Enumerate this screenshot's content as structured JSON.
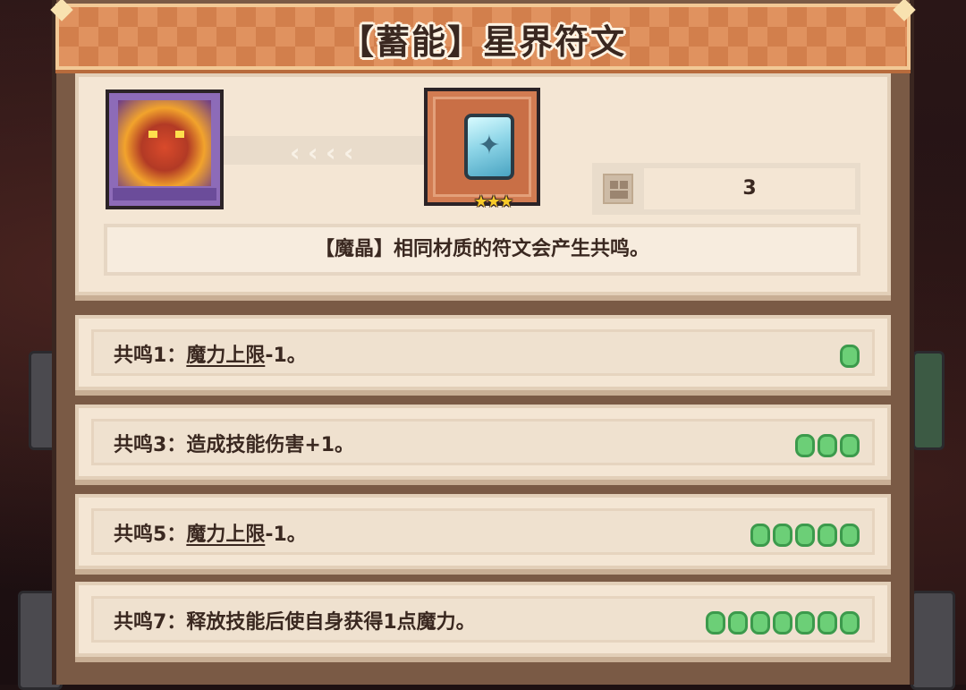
{
  "title": "【蓄能】星界符文",
  "rune": {
    "stars": "★★★",
    "count": "3",
    "description": "【魔晶】相同材质的符文会产生共鸣。"
  },
  "effects": [
    {
      "prefix": "共鸣1：",
      "keyword": "魔力上限",
      "suffix": "-1。",
      "pips": 1
    },
    {
      "prefix": "共鸣3：",
      "keyword": "",
      "suffix": "造成技能伤害+1。",
      "pips": 3
    },
    {
      "prefix": "共鸣5：",
      "keyword": "魔力上限",
      "suffix": "-1。",
      "pips": 5
    },
    {
      "prefix": "共鸣7：",
      "keyword": "",
      "suffix": "释放技能后使自身获得1点魔力。",
      "pips": 7
    }
  ],
  "colors": {
    "pip_fill": "#6ccf77",
    "pip_border": "#3c9a4c",
    "panel": "#f4e6d4",
    "header": "#e0925f"
  },
  "icons": [
    "hero-portrait",
    "chevron-left-icon",
    "crystal-rune-icon",
    "star-icon",
    "quantity-icon",
    "resonance-pip-icon"
  ]
}
